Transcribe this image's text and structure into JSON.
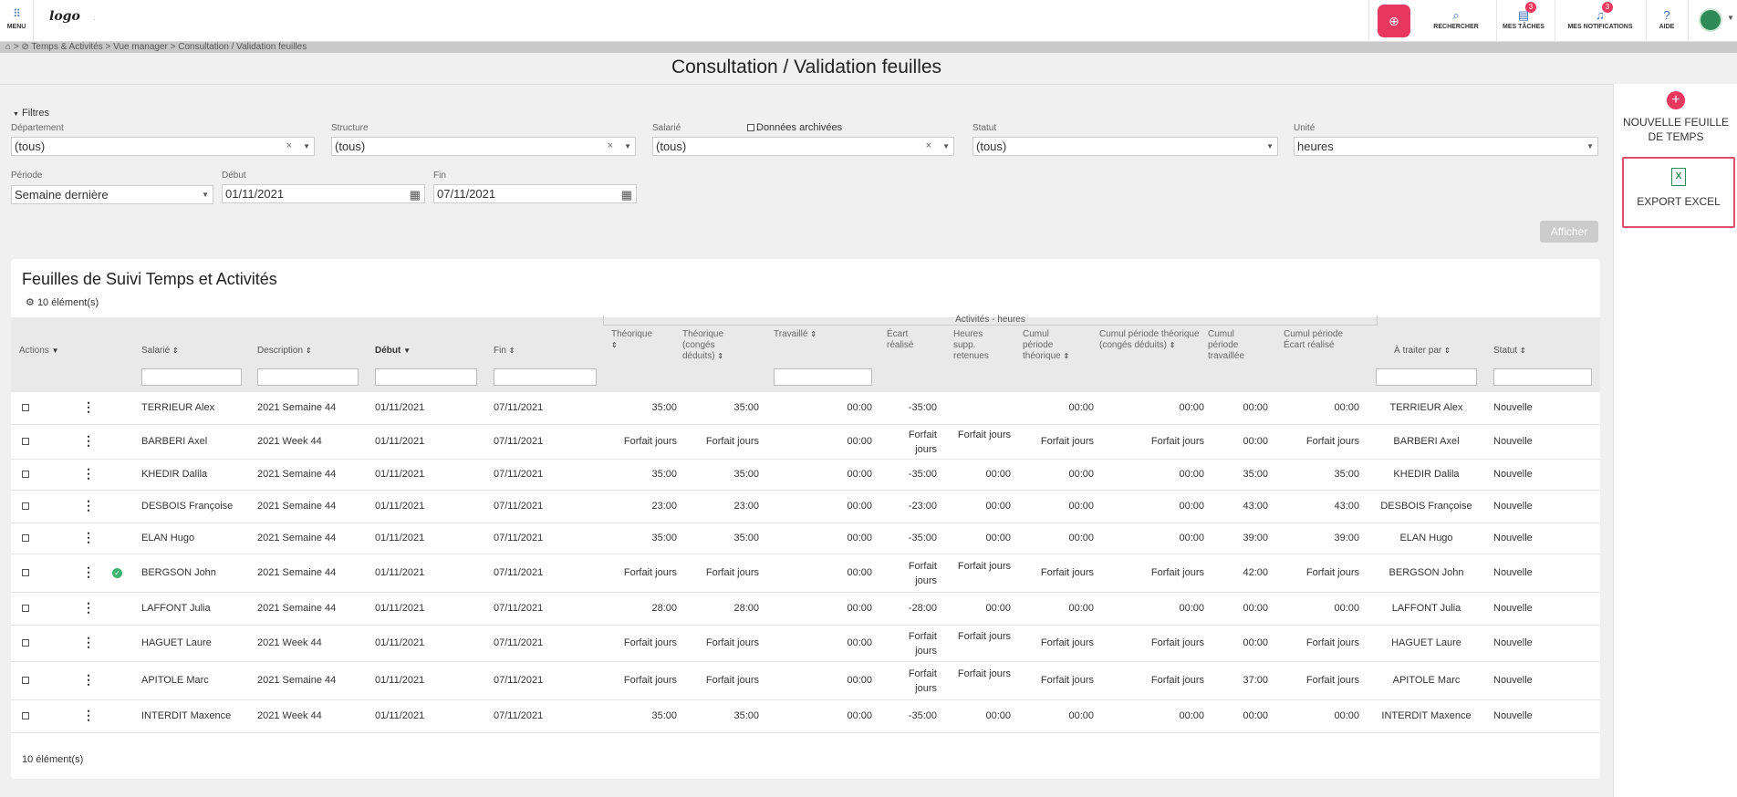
{
  "topbar": {
    "menu_label": "MENU",
    "logo_text": "logo",
    "dot": "·",
    "items": [
      {
        "label": "RECHERCHER",
        "icon": "search-icon",
        "badge": ""
      },
      {
        "label": "MES TÂCHES",
        "icon": "tasks-icon",
        "badge": "3"
      },
      {
        "label": "MES NOTIFICATIONS",
        "icon": "bell-icon",
        "badge": "3"
      },
      {
        "label": "AIDE",
        "icon": "help-icon",
        "badge": ""
      }
    ]
  },
  "breadcrumb": "⌂ > ⊘ Temps & Activités > Vue manager > Consultation / Validation feuilles",
  "page_title": "Consultation / Validation feuilles",
  "right_panel": {
    "new_sheet_label": "NOUVELLE FEUILLE DE TEMPS",
    "export_label": "EXPORT EXCEL"
  },
  "filters": {
    "toggle_label": "Filtres",
    "departement": {
      "label": "Département",
      "value": "(tous)"
    },
    "structure": {
      "label": "Structure",
      "value": "(tous)"
    },
    "salarie": {
      "label": "Salarié",
      "value": "(tous)"
    },
    "archived_label": "Données archivées",
    "statut": {
      "label": "Statut",
      "value": "(tous)"
    },
    "unite": {
      "label": "Unité",
      "value": "heures"
    },
    "periode": {
      "label": "Période",
      "value": "Semaine dernière"
    },
    "debut": {
      "label": "Début",
      "value": "01/11/2021"
    },
    "fin": {
      "label": "Fin",
      "value": "07/11/2021"
    },
    "submit_label": "Afficher"
  },
  "table": {
    "title": "Feuilles de Suivi Temps et Activités",
    "count_label": "10 élément(s)",
    "group_header": "Activités - heures",
    "headers": {
      "actions": "Actions",
      "salarie": "Salarié",
      "description": "Description",
      "debut": "Début",
      "fin": "Fin",
      "theorique": "Théorique",
      "theorique_conges": "Théorique (congés déduits)",
      "travaille": "Travaillé",
      "ecart": "Écart réalisé",
      "heures_supp": "Heures supp. retenues",
      "cumul_theorique": "Cumul période théorique",
      "cumul_theorique_conges": "Cumul période théorique (congés déduits)",
      "cumul_travaillee": "Cumul période travaillée",
      "cumul_ecart": "Cumul période Écart réalisé",
      "a_traiter": "À traiter par",
      "statut": "Statut"
    },
    "rows": [
      {
        "salarie": "TERRIEUR Alex",
        "description": "2021 Semaine 44",
        "debut": "01/11/2021",
        "fin": "07/11/2021",
        "theorique": "35:00",
        "theorique_conges": "35:00",
        "travaille": "00:00",
        "ecart": "-35:00",
        "heures_supp": "",
        "cumul_theorique": "00:00",
        "cumul_theorique_conges": "00:00",
        "cumul_travaillee": "00:00",
        "cumul_ecart": "00:00",
        "a_traiter": "TERRIEUR Alex",
        "statut": "Nouvelle",
        "validated": false
      },
      {
        "salarie": "BARBERI Axel",
        "description": "2021 Week 44",
        "debut": "01/11/2021",
        "fin": "07/11/2021",
        "theorique": "Forfait jours",
        "theorique_conges": "Forfait jours",
        "travaille": "00:00",
        "ecart": "Forfait jours",
        "heures_supp": "Forfait jours",
        "cumul_theorique": "Forfait jours",
        "cumul_theorique_conges": "Forfait jours",
        "cumul_travaillee": "00:00",
        "cumul_ecart": "Forfait jours",
        "a_traiter": "BARBERI Axel",
        "statut": "Nouvelle",
        "validated": false
      },
      {
        "salarie": "KHEDIR Dalila",
        "description": "2021 Semaine 44",
        "debut": "01/11/2021",
        "fin": "07/11/2021",
        "theorique": "35:00",
        "theorique_conges": "35:00",
        "travaille": "00:00",
        "ecart": "-35:00",
        "heures_supp": "00:00",
        "cumul_theorique": "00:00",
        "cumul_theorique_conges": "00:00",
        "cumul_travaillee": "35:00",
        "cumul_ecart": "35:00",
        "a_traiter": "KHEDIR Dalila",
        "statut": "Nouvelle",
        "validated": false
      },
      {
        "salarie": "DESBOIS Françoise",
        "description": "2021 Semaine 44",
        "debut": "01/11/2021",
        "fin": "07/11/2021",
        "theorique": "23:00",
        "theorique_conges": "23:00",
        "travaille": "00:00",
        "ecart": "-23:00",
        "heures_supp": "00:00",
        "cumul_theorique": "00:00",
        "cumul_theorique_conges": "00:00",
        "cumul_travaillee": "43:00",
        "cumul_ecart": "43:00",
        "a_traiter": "DESBOIS Françoise",
        "statut": "Nouvelle",
        "validated": false
      },
      {
        "salarie": "ELAN Hugo",
        "description": "2021 Semaine 44",
        "debut": "01/11/2021",
        "fin": "07/11/2021",
        "theorique": "35:00",
        "theorique_conges": "35:00",
        "travaille": "00:00",
        "ecart": "-35:00",
        "heures_supp": "00:00",
        "cumul_theorique": "00:00",
        "cumul_theorique_conges": "00:00",
        "cumul_travaillee": "39:00",
        "cumul_ecart": "39:00",
        "a_traiter": "ELAN Hugo",
        "statut": "Nouvelle",
        "validated": false
      },
      {
        "salarie": "BERGSON John",
        "description": "2021 Semaine 44",
        "debut": "01/11/2021",
        "fin": "07/11/2021",
        "theorique": "Forfait jours",
        "theorique_conges": "Forfait jours",
        "travaille": "00:00",
        "ecart": "Forfait jours",
        "heures_supp": "Forfait jours",
        "cumul_theorique": "Forfait jours",
        "cumul_theorique_conges": "Forfait jours",
        "cumul_travaillee": "42:00",
        "cumul_ecart": "Forfait jours",
        "a_traiter": "BERGSON John",
        "statut": "Nouvelle",
        "validated": true
      },
      {
        "salarie": "LAFFONT Julia",
        "description": "2021 Semaine 44",
        "debut": "01/11/2021",
        "fin": "07/11/2021",
        "theorique": "28:00",
        "theorique_conges": "28:00",
        "travaille": "00:00",
        "ecart": "-28:00",
        "heures_supp": "00:00",
        "cumul_theorique": "00:00",
        "cumul_theorique_conges": "00:00",
        "cumul_travaillee": "00:00",
        "cumul_ecart": "00:00",
        "a_traiter": "LAFFONT Julia",
        "statut": "Nouvelle",
        "validated": false
      },
      {
        "salarie": "HAGUET Laure",
        "description": "2021 Week 44",
        "debut": "01/11/2021",
        "fin": "07/11/2021",
        "theorique": "Forfait jours",
        "theorique_conges": "Forfait jours",
        "travaille": "00:00",
        "ecart": "Forfait jours",
        "heures_supp": "Forfait jours",
        "cumul_theorique": "Forfait jours",
        "cumul_theorique_conges": "Forfait jours",
        "cumul_travaillee": "00:00",
        "cumul_ecart": "Forfait jours",
        "a_traiter": "HAGUET Laure",
        "statut": "Nouvelle",
        "validated": false
      },
      {
        "salarie": "APITOLE Marc",
        "description": "2021 Semaine 44",
        "debut": "01/11/2021",
        "fin": "07/11/2021",
        "theorique": "Forfait jours",
        "theorique_conges": "Forfait jours",
        "travaille": "00:00",
        "ecart": "Forfait jours",
        "heures_supp": "Forfait jours",
        "cumul_theorique": "Forfait jours",
        "cumul_theorique_conges": "Forfait jours",
        "cumul_travaillee": "37:00",
        "cumul_ecart": "Forfait jours",
        "a_traiter": "APITOLE Marc",
        "statut": "Nouvelle",
        "validated": false
      },
      {
        "salarie": "INTERDIT Maxence",
        "description": "2021 Week 44",
        "debut": "01/11/2021",
        "fin": "07/11/2021",
        "theorique": "35:00",
        "theorique_conges": "35:00",
        "travaille": "00:00",
        "ecart": "-35:00",
        "heures_supp": "00:00",
        "cumul_theorique": "00:00",
        "cumul_theorique_conges": "00:00",
        "cumul_travaillee": "00:00",
        "cumul_ecart": "00:00",
        "a_traiter": "INTERDIT Maxence",
        "statut": "Nouvelle",
        "validated": false
      }
    ]
  },
  "colors": {
    "accent": "#e8385f",
    "brand_blue": "#3b6fb5",
    "excel_green": "#2e8b57",
    "highlight_border": "#e0506e"
  }
}
